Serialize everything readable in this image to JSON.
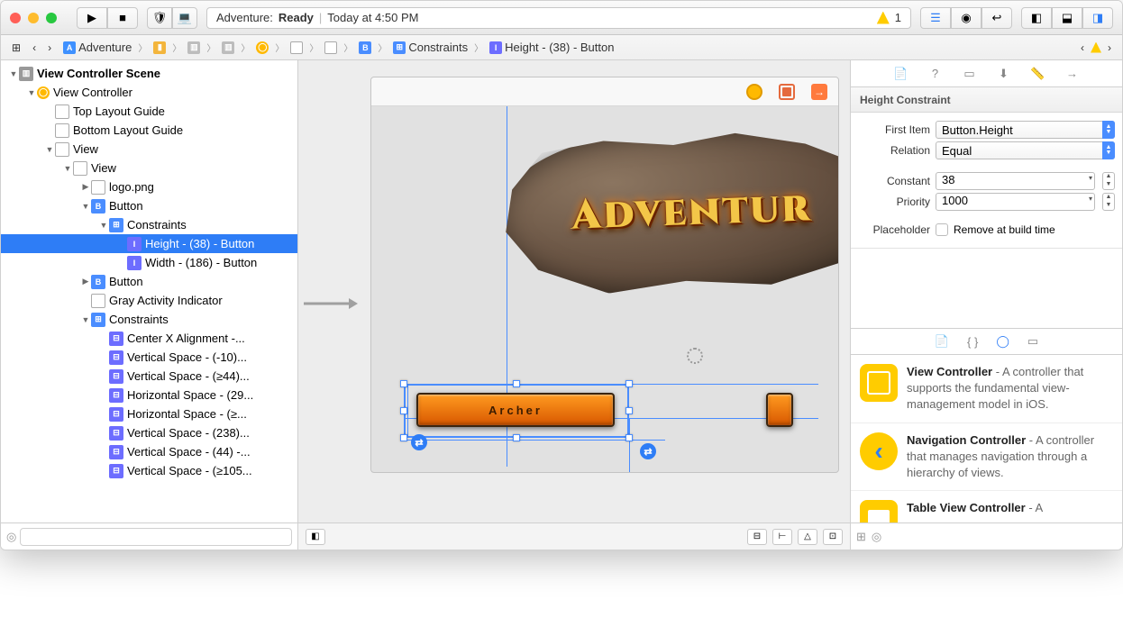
{
  "toolbar": {
    "scheme": "Adventure:",
    "status": "Ready",
    "status_detail": "Today at 4:50 PM",
    "warn_count": "1"
  },
  "jumpbar": {
    "segments": [
      {
        "icon": "#3f91ff",
        "iconText": "",
        "label": "Adventure"
      },
      {
        "icon": "#f3b53c",
        "iconText": "",
        "label": ""
      },
      {
        "icon": "#bdbdbd",
        "iconText": "",
        "label": ""
      },
      {
        "icon": "#bdbdbd",
        "iconText": "",
        "label": ""
      },
      {
        "icon": "#ffb900",
        "iconText": "",
        "label": ""
      },
      {
        "icon": "#ddd",
        "iconText": "",
        "label": ""
      },
      {
        "icon": "#ddd",
        "iconText": "",
        "label": ""
      },
      {
        "icon": "#4a8dff",
        "iconText": "B",
        "label": ""
      },
      {
        "icon": "#4a8dff",
        "iconText": "⊞",
        "label": "Constraints"
      },
      {
        "icon": "#6d6dff",
        "iconText": "I",
        "label": "Height - (38) - Button"
      }
    ]
  },
  "tree": {
    "scene": "View Controller Scene",
    "vc": "View Controller",
    "top_guide": "Top Layout Guide",
    "bottom_guide": "Bottom Layout Guide",
    "view1": "View",
    "view2": "View",
    "logo": "logo.png",
    "button1": "Button",
    "constraints1": "Constraints",
    "height_c": "Height - (38) - Button",
    "width_c": "Width - (186) - Button",
    "button2": "Button",
    "gray_act": "Gray Activity Indicator",
    "constraints2": "Constraints",
    "c_centerx": "Center X Alignment -...",
    "c_vs1": "Vertical Space - (-10)...",
    "c_vs2": "Vertical Space - (≥44)...",
    "c_hs1": "Horizontal Space - (29...",
    "c_hs2": "Horizontal Space - (≥...",
    "c_vs3": "Vertical Space - (238)...",
    "c_vs4": "Vertical Space - (44) -...",
    "c_vs5": "Vertical Space - (≥105..."
  },
  "canvas": {
    "logo_text": "Adventur",
    "button_label": "Archer"
  },
  "inspector": {
    "section_title": "Height Constraint",
    "first_item_label": "First Item",
    "first_item_value": "Button.Height",
    "relation_label": "Relation",
    "relation_value": "Equal",
    "constant_label": "Constant",
    "constant_value": "38",
    "priority_label": "Priority",
    "priority_value": "1000",
    "placeholder_label": "Placeholder",
    "placeholder_check": "Remove at build time"
  },
  "library": {
    "items": [
      {
        "title": "View Controller",
        "desc": " - A controller that supports the fundamental view-management model in iOS."
      },
      {
        "title": "Navigation Controller",
        "desc": " - A controller that manages navigation through a hierarchy of views."
      },
      {
        "title": "Table View Controller",
        "desc": " - A"
      }
    ]
  }
}
